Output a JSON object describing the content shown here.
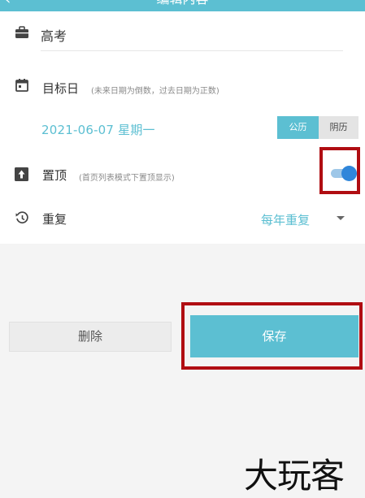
{
  "header": {
    "back_icon": "back-arrow-icon",
    "title": "编辑内容"
  },
  "fields": {
    "event_name": {
      "icon": "briefcase-icon",
      "value": "高考"
    },
    "target_date": {
      "icon": "calendar-icon",
      "label": "目标日",
      "hint": "(未来日期为倒数，过去日期为正数)",
      "value": "2021-06-07 星期一",
      "calendar_options": [
        "公历",
        "阴历"
      ],
      "selected_calendar": "公历"
    },
    "pin": {
      "icon": "pin-top-icon",
      "label": "置顶",
      "hint": "(首页列表模式下置顶显示)",
      "enabled": true
    },
    "repeat": {
      "icon": "history-icon",
      "label": "重复",
      "value": "每年重复",
      "dropdown_icon": "caret-down-icon"
    }
  },
  "actions": {
    "delete_label": "删除",
    "save_label": "保存"
  },
  "annotations": {
    "highlight_color": "#b00d12"
  },
  "watermark": "大玩客",
  "colors": {
    "accent": "#5cbfd2",
    "switch_on": "#2f86da",
    "text": "#333333"
  }
}
